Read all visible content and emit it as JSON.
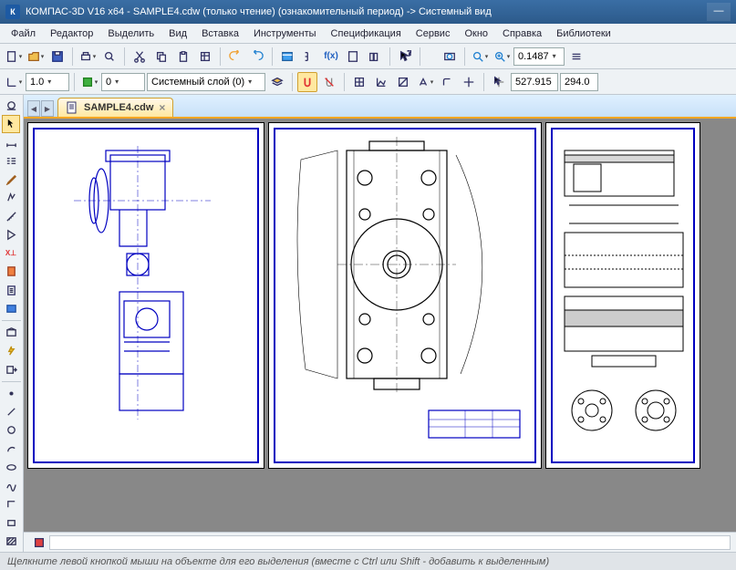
{
  "titlebar": {
    "app_title": "КОМПАС-3D V16  x64 - SAMPLE4.cdw (только чтение) (ознакомительный период) -> Системный вид",
    "app_icon_text": "К"
  },
  "menu": {
    "items": [
      "Файл",
      "Редактор",
      "Выделить",
      "Вид",
      "Вставка",
      "Инструменты",
      "Спецификация",
      "Сервис",
      "Окно",
      "Справка",
      "Библиотеки"
    ]
  },
  "toolbar1": {
    "fx_label": "f(x)",
    "zoom_value": "0.1487"
  },
  "toolbar2": {
    "step_value": "1.0",
    "num_value": "0",
    "layer_label": "Системный слой (0)",
    "coord_x": "527.915",
    "coord_y": "294.0"
  },
  "tab": {
    "filename": "SAMPLE4.cdw"
  },
  "statusbar": {
    "hint": "Щелкните левой кнопкой мыши на объекте для его выделения (вместе с Ctrl или Shift - добавить к выделенным)"
  }
}
